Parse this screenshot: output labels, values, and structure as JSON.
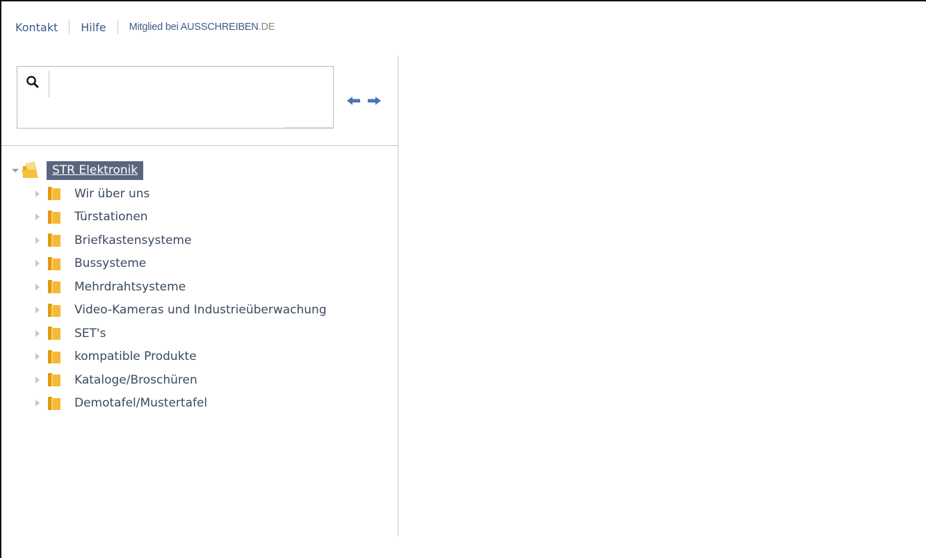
{
  "topnav": {
    "contact": "Kontakt",
    "help": "Hilfe",
    "member_prefix": "Mitglied bei ",
    "member_brand": "AUSSCHREIBEN",
    "member_tld": ".DE"
  },
  "search": {
    "value": "",
    "placeholder": "",
    "icon": "magnifier-icon"
  },
  "navigation": {
    "back_icon": "arrow-left-icon",
    "forward_icon": "arrow-right-icon",
    "arrow_color": "#4a74b8"
  },
  "tree": {
    "root": {
      "label": "STR Elektronik",
      "expanded": true
    },
    "items": [
      {
        "label": "Wir über uns"
      },
      {
        "label": "Türstationen"
      },
      {
        "label": "Briefkastensysteme"
      },
      {
        "label": "Bussysteme"
      },
      {
        "label": "Mehrdrahtsysteme"
      },
      {
        "label": "Video-Kameras und Industrieüberwachung"
      },
      {
        "label": "SET's"
      },
      {
        "label": "kompatible Produkte"
      },
      {
        "label": "Kataloge/Broschüren"
      },
      {
        "label": "Demotafel/Mustertafel"
      }
    ]
  },
  "colors": {
    "selected_bg": "#5a6680",
    "folder": "#f4b52a",
    "link": "#3c5a8a",
    "text": "#3a4a5e"
  }
}
